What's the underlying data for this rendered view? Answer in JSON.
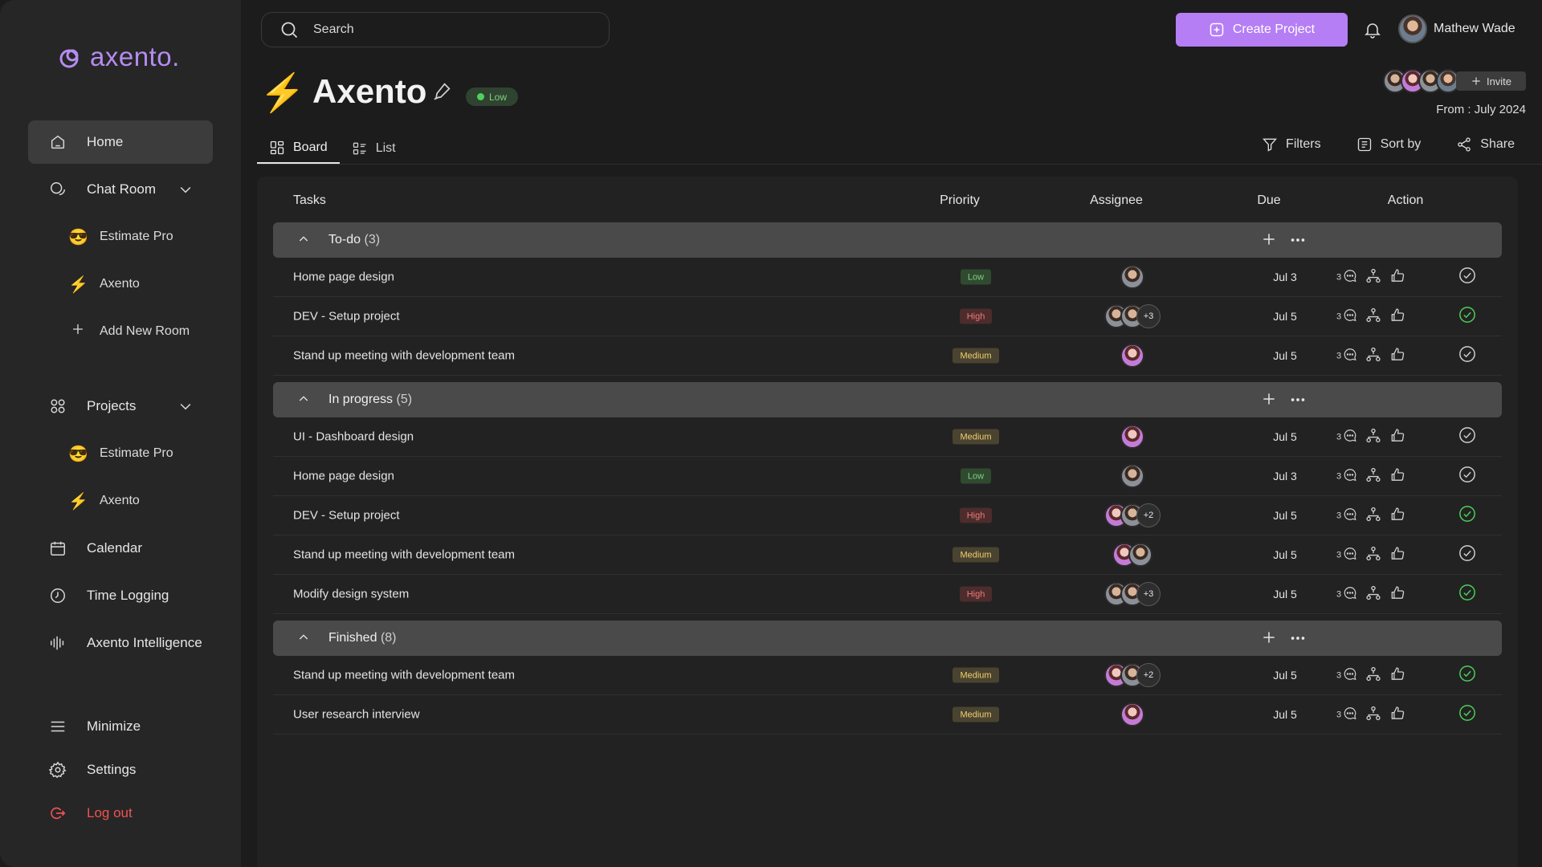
{
  "brand": {
    "name": "axento.",
    "accent": "#b57ef5"
  },
  "sidebar": {
    "items": [
      {
        "label": "Home",
        "icon": "home-icon",
        "active": true
      },
      {
        "label": "Chat Room",
        "icon": "chat-icon"
      },
      {
        "label": "Projects",
        "icon": "grid-icon"
      },
      {
        "label": "Calendar",
        "icon": "calendar-icon"
      },
      {
        "label": "Time Logging",
        "icon": "clock-icon"
      },
      {
        "label": "Axento Intelligence",
        "icon": "waveform-icon"
      }
    ],
    "chat_rooms": [
      {
        "label": "Estimate Pro",
        "icon": "sunglasses-emoji"
      },
      {
        "label": "Axento",
        "icon": "lightning-icon"
      }
    ],
    "add_room": "Add New Room",
    "projects": [
      {
        "label": "Estimate Pro",
        "icon": "sunglasses-emoji"
      },
      {
        "label": "Axento",
        "icon": "lightning-icon"
      }
    ],
    "bottom": {
      "minimize": "Minimize",
      "settings": "Settings",
      "logout": "Log out"
    }
  },
  "search": {
    "placeholder": "Search"
  },
  "topbar": {
    "create_label": "Create Project",
    "user_name": "Mathew Wade"
  },
  "project": {
    "title": "Axento",
    "status": "Low",
    "invite_label": "Invite",
    "from_label": "From :",
    "from_date": "July 2024"
  },
  "tabs": [
    {
      "label": "Board",
      "active": true
    },
    {
      "label": "List",
      "active": false
    }
  ],
  "toolbar": {
    "filters": "Filters",
    "sort": "Sort by",
    "share": "Share"
  },
  "table": {
    "headers": {
      "tasks": "Tasks",
      "priority": "Priority",
      "assignee": "Assignee",
      "due": "Due",
      "action": "Action"
    },
    "groups": [
      {
        "name": "To-do",
        "count": "(3)",
        "rows": [
          {
            "task": "Home page design",
            "priority": "Low",
            "assignees": [
              "gray"
            ],
            "extra": "",
            "due": "Jul 3",
            "comments": "3",
            "done": false
          },
          {
            "task": "DEV - Setup project",
            "priority": "High",
            "assignees": [
              "gray",
              "gray"
            ],
            "extra": "+3",
            "due": "Jul 5",
            "comments": "3",
            "done": true
          },
          {
            "task": "Stand up meeting with development team",
            "priority": "Medium",
            "assignees": [
              "purple"
            ],
            "extra": "",
            "due": "Jul 5",
            "comments": "3",
            "done": false
          }
        ]
      },
      {
        "name": "In progress",
        "count": "(5)",
        "rows": [
          {
            "task": "UI - Dashboard design",
            "priority": "Medium",
            "assignees": [
              "purple"
            ],
            "extra": "",
            "due": "Jul 5",
            "comments": "3",
            "done": false
          },
          {
            "task": "Home page design",
            "priority": "Low",
            "assignees": [
              "gray"
            ],
            "extra": "",
            "due": "Jul 3",
            "comments": "3",
            "done": false
          },
          {
            "task": "DEV - Setup project",
            "priority": "High",
            "assignees": [
              "purple",
              "gray"
            ],
            "extra": "+2",
            "due": "Jul 5",
            "comments": "3",
            "done": true
          },
          {
            "task": "Stand up meeting with development team",
            "priority": "Medium",
            "assignees": [
              "purple",
              "gray"
            ],
            "extra": "",
            "due": "Jul 5",
            "comments": "3",
            "done": false
          },
          {
            "task": "Modify design system",
            "priority": "High",
            "assignees": [
              "gray",
              "gray"
            ],
            "extra": "+3",
            "due": "Jul 5",
            "comments": "3",
            "done": true
          }
        ]
      },
      {
        "name": "Finished",
        "count": "(8)",
        "rows": [
          {
            "task": "Stand up meeting with development team",
            "priority": "Medium",
            "assignees": [
              "purple",
              "gray"
            ],
            "extra": "+2",
            "due": "Jul 5",
            "comments": "3",
            "done": true
          },
          {
            "task": "User research interview",
            "priority": "Medium",
            "assignees": [
              "purple"
            ],
            "extra": "",
            "due": "Jul 5",
            "comments": "3",
            "done": true
          }
        ]
      }
    ]
  },
  "colors": {
    "done_check": "#4ed05a",
    "open_check": "#cfcfcf"
  }
}
